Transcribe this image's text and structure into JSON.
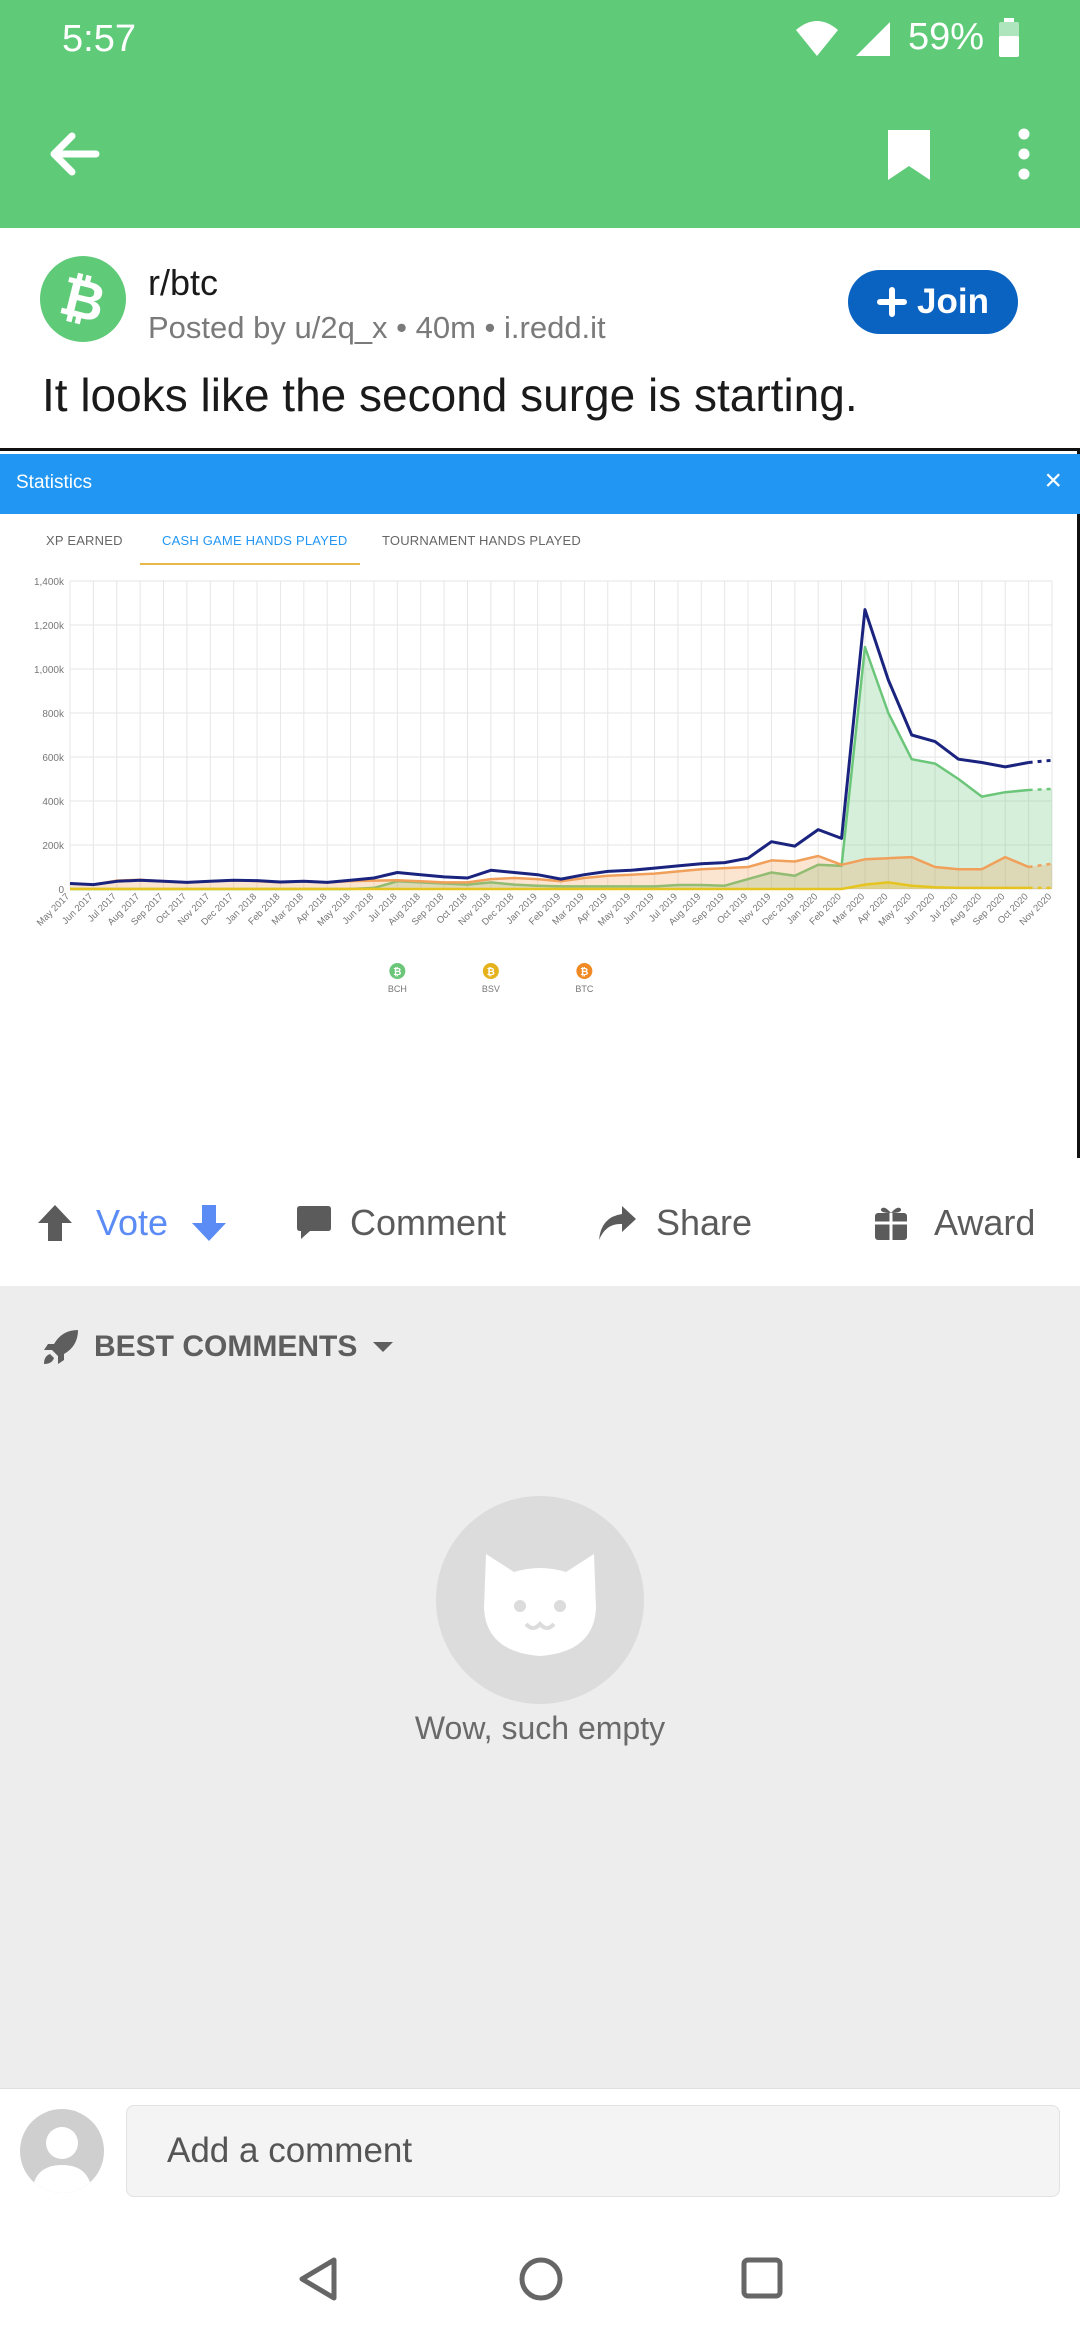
{
  "status": {
    "time": "5:57",
    "battery": "59%"
  },
  "post": {
    "subreddit": "r/btc",
    "meta": "Posted by u/2q_x • 40m • i.redd.it",
    "join_label": "Join",
    "title": "It looks like the second surge is starting."
  },
  "embed": {
    "header": "Statistics",
    "close": "×",
    "tabs": [
      "XP EARNED",
      "CASH GAME HANDS PLAYED",
      "TOURNAMENT HANDS PLAYED"
    ],
    "active_tab": 1
  },
  "chart_data": {
    "type": "area",
    "title": "",
    "xlabel": "",
    "ylabel": "",
    "ylim": [
      0,
      1400
    ],
    "y_ticks": [
      "0",
      "200k",
      "400k",
      "600k",
      "800k",
      "1,000k",
      "1,200k",
      "1,400k"
    ],
    "y_tick_values": [
      0,
      200,
      400,
      600,
      800,
      1000,
      1200,
      1400
    ],
    "grid": true,
    "categories": [
      "May 2017",
      "Jun 2017",
      "Jul 2017",
      "Aug 2017",
      "Sep 2017",
      "Oct 2017",
      "Nov 2017",
      "Dec 2017",
      "Jan 2018",
      "Feb 2018",
      "Mar 2018",
      "Apr 2018",
      "May 2018",
      "Jun 2018",
      "Jul 2018",
      "Aug 2018",
      "Sep 2018",
      "Oct 2018",
      "Nov 2018",
      "Dec 2018",
      "Jan 2019",
      "Feb 2019",
      "Mar 2019",
      "Apr 2019",
      "May 2019",
      "Jun 2019",
      "Jul 2019",
      "Aug 2019",
      "Sep 2019",
      "Oct 2019",
      "Nov 2019",
      "Dec 2019",
      "Jan 2020",
      "Feb 2020",
      "Mar 2020",
      "Apr 2020",
      "May 2020",
      "Jun 2020",
      "Jul 2020",
      "Aug 2020",
      "Sep 2020",
      "Oct 2020",
      "Nov 2020"
    ],
    "series": [
      {
        "color": "#1A237E",
        "fill": false,
        "values": [
          25,
          20,
          35,
          40,
          35,
          30,
          35,
          40,
          38,
          32,
          35,
          30,
          40,
          50,
          75,
          65,
          55,
          50,
          85,
          75,
          65,
          45,
          65,
          80,
          85,
          95,
          105,
          115,
          120,
          140,
          215,
          195,
          270,
          230,
          1270,
          950,
          700,
          670,
          590,
          575,
          555,
          575,
          585
        ]
      },
      {
        "color": "#6CC67A",
        "fill": true,
        "values": [
          0,
          0,
          0,
          0,
          0,
          0,
          0,
          0,
          0,
          0,
          0,
          0,
          0,
          5,
          35,
          30,
          25,
          20,
          30,
          20,
          15,
          12,
          12,
          12,
          12,
          12,
          18,
          18,
          15,
          45,
          75,
          60,
          110,
          105,
          1100,
          800,
          590,
          570,
          500,
          420,
          440,
          450,
          455
        ]
      },
      {
        "color": "#F0A05A",
        "fill": true,
        "values": [
          25,
          20,
          38,
          42,
          35,
          30,
          35,
          40,
          36,
          30,
          36,
          30,
          36,
          38,
          40,
          35,
          30,
          30,
          45,
          50,
          45,
          35,
          50,
          60,
          65,
          70,
          80,
          90,
          95,
          100,
          130,
          125,
          150,
          110,
          135,
          140,
          145,
          100,
          90,
          90,
          145,
          100,
          115
        ]
      },
      {
        "color": "#E5C420",
        "fill": true,
        "values": [
          0,
          0,
          0,
          0,
          0,
          0,
          0,
          0,
          0,
          0,
          0,
          0,
          0,
          0,
          0,
          0,
          0,
          0,
          0,
          0,
          0,
          0,
          0,
          0,
          0,
          0,
          0,
          0,
          0,
          0,
          0,
          0,
          0,
          0,
          20,
          30,
          15,
          8,
          5,
          5,
          5,
          5,
          5
        ]
      }
    ],
    "markers": [
      {
        "label": "BCH",
        "at": "Jul 2018",
        "color": "#6CC67A"
      },
      {
        "label": "BSV",
        "at": "Nov 2018",
        "color": "#E5B21E"
      },
      {
        "label": "BTC",
        "at": "Mar 2019",
        "color": "#F08A24"
      }
    ]
  },
  "actions": {
    "vote": "Vote",
    "comment": "Comment",
    "share": "Share",
    "award": "Award"
  },
  "comments": {
    "sort_label": "BEST COMMENTS",
    "empty_text": "Wow, such empty"
  },
  "composer": {
    "placeholder": "Add a comment"
  },
  "colors": {
    "app_bar": "#5FCB78",
    "join_button": "#0A62C1",
    "chart_header": "#2196F3",
    "vote_accent": "#5B8CF5"
  }
}
